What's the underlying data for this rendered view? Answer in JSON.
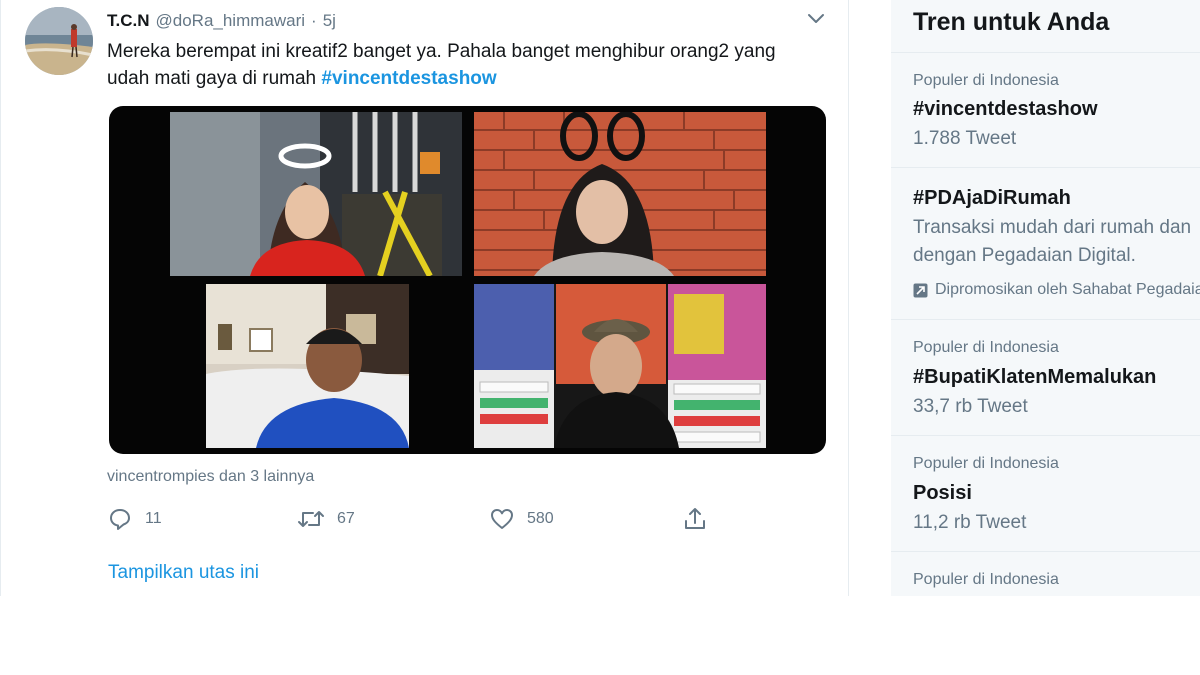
{
  "tweet": {
    "display_name": "T.C.N",
    "handle": "@doRa_himmawari",
    "separator": "·",
    "time": "5j",
    "text_main": "Mereka berempat ini kreatif2 banget ya. Pahala banget menghibur orang2 yang udah mati gaya di rumah ",
    "hashtag": "#vincentdestashow",
    "social_context": "vincentrompies dan 3 lainnya",
    "actions": {
      "reply_count": "11",
      "retweet_count": "67",
      "like_count": "580"
    },
    "show_thread": "Tampilkan utas ini"
  },
  "sidebar": {
    "title": "Tren untuk Anda",
    "trends": [
      {
        "context": "Populer di Indonesia",
        "name": "#vincentdestashow",
        "count": "1.788 Tweet"
      },
      {
        "name": "#PDAjaDiRumah",
        "description_1": "Transaksi mudah dari rumah dan",
        "description_2": "dengan Pegadaian Digital.",
        "promoted": "Dipromosikan oleh Sahabat Pegadaian"
      },
      {
        "context": "Populer di Indonesia",
        "name": "#BupatiKlatenMemalukan",
        "count": "33,7 rb Tweet"
      },
      {
        "context": "Populer di Indonesia",
        "name": "Posisi",
        "count": "11,2 rb Tweet"
      },
      {
        "context": "Populer di Indonesia"
      }
    ]
  },
  "colors": {
    "accent": "#1b95e0",
    "secondary_text": "#657786",
    "primary_text": "#14171a",
    "sidebar_bg": "#f5f8fa"
  },
  "icons": {
    "reply": "reply-icon",
    "retweet": "retweet-icon",
    "like": "heart-icon",
    "share": "share-icon",
    "caret": "chevron-down-icon",
    "promoted": "promoted-icon"
  }
}
